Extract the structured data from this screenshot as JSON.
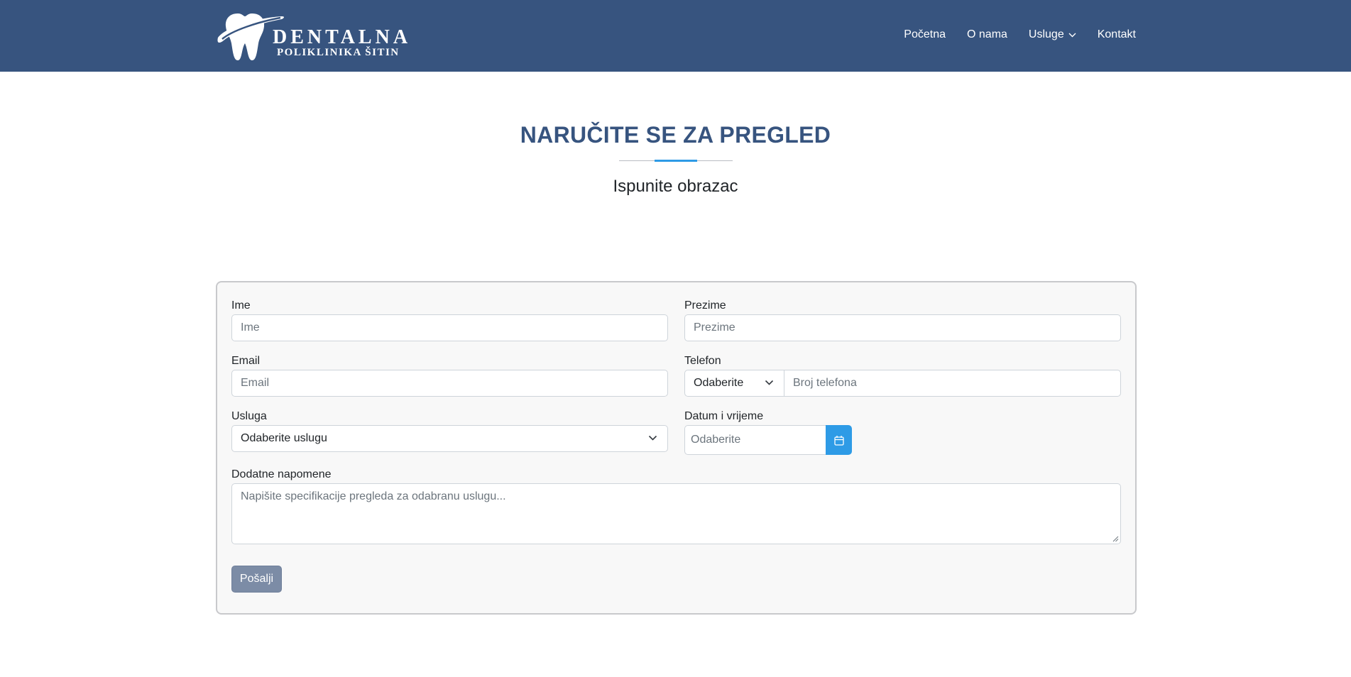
{
  "header": {
    "logo": {
      "brand_line1": "DENTALNA",
      "brand_line2": "POLIKLINIKA ŠITIN",
      "icon": "tooth-logo-icon"
    },
    "nav": [
      {
        "label": "Početna"
      },
      {
        "label": "O nama"
      },
      {
        "label": "Usluge",
        "icon": "chevron-down-icon"
      },
      {
        "label": "Kontakt"
      }
    ]
  },
  "main": {
    "title": "NARUČITE SE ZA PREGLED",
    "subtitle": "Ispunite obrazac"
  },
  "form": {
    "first_name": {
      "label": "Ime",
      "placeholder": "Ime"
    },
    "last_name": {
      "label": "Prezime",
      "placeholder": "Prezime"
    },
    "email": {
      "label": "Email",
      "placeholder": "Email"
    },
    "phone": {
      "label": "Telefon",
      "prefix_value": "Odaberite",
      "placeholder": "Broj telefona"
    },
    "service": {
      "label": "Usluga",
      "value": "Odaberite uslugu"
    },
    "datetime": {
      "label": "Datum i vrijeme",
      "placeholder": "Odaberite",
      "icon": "calendar-icon"
    },
    "notes": {
      "label": "Dodatne napomene",
      "placeholder": "Napišite specifikacije pregleda za odabranu uslugu..."
    },
    "submit_label": "Pošalji"
  },
  "colors": {
    "header_bg": "#37547f",
    "title": "#37547f",
    "accent": "#2e9be6",
    "submit_bg": "#7c8ca6"
  }
}
